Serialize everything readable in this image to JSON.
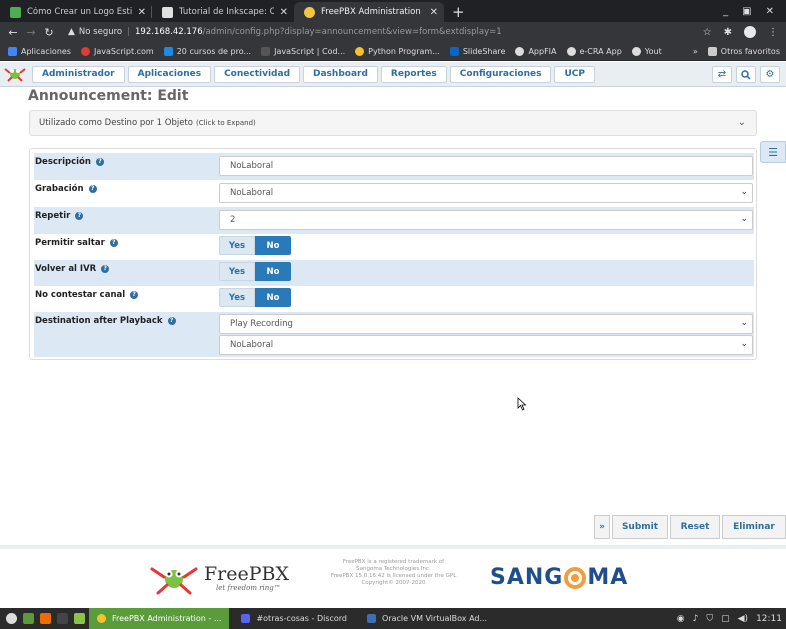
{
  "browser": {
    "tabs": [
      {
        "title": "Cómo Crear un Logo Estilo G",
        "favicon_color": "#4caf50",
        "active": false
      },
      {
        "title": "Tutorial de Inkscape: Cómo d",
        "favicon_color": "#e0e0e0",
        "active": false
      },
      {
        "title": "FreePBX Administration",
        "favicon_color": "#f5c542",
        "active": true
      }
    ],
    "url": {
      "security_label": "No seguro",
      "host": "192.168.42.176",
      "path": "/admin/config.php?display=announcement&view=form&extdisplay=1"
    },
    "bookmarks": [
      {
        "label": "Aplicaciones",
        "color": "#4285f4"
      },
      {
        "label": "JavaScript.com",
        "color": "#e53935"
      },
      {
        "label": "20 cursos de pro...",
        "color": "#1e88e5"
      },
      {
        "label": "JavaScript | Cod...",
        "color": "#555555"
      },
      {
        "label": "Python Program...",
        "color": "#fbc02d"
      },
      {
        "label": "SlideShare",
        "color": "#0a66c2"
      },
      {
        "label": "AppFIA",
        "color": "#dddddd"
      },
      {
        "label": "e-CRA App",
        "color": "#dddddd"
      },
      {
        "label": "Yout",
        "color": "#dddddd"
      }
    ],
    "bookmarks_overflow": "»",
    "other_bookmarks": "Otros favoritos"
  },
  "nav": {
    "items": [
      "Administrador",
      "Aplicaciones",
      "Conectividad",
      "Dashboard",
      "Reportes",
      "Configuraciones",
      "UCP"
    ]
  },
  "page": {
    "title": "Announcement: Edit",
    "used_as": "Utilizado como Destino por 1 Objeto",
    "used_as_hint": "(Click to Expand)"
  },
  "form": {
    "descripcion": {
      "label": "Descripción",
      "value": "NoLaboral"
    },
    "grabacion": {
      "label": "Grabación",
      "value": "NoLaboral"
    },
    "repetir": {
      "label": "Repetir",
      "value": "2"
    },
    "permitir_saltar": {
      "label": "Permitir saltar",
      "yes": "Yes",
      "no": "No",
      "selected": "No"
    },
    "volver_ivr": {
      "label": "Volver al IVR",
      "yes": "Yes",
      "no": "No",
      "selected": "No"
    },
    "no_contestar": {
      "label": "No contestar canal",
      "yes": "Yes",
      "no": "No",
      "selected": "No"
    },
    "destination": {
      "label": "Destination after Playback",
      "type_value": "Play Recording",
      "target_value": "NoLaboral"
    }
  },
  "actions": {
    "expand": "»",
    "submit": "Submit",
    "reset": "Reset",
    "delete": "Eliminar"
  },
  "footer": {
    "brand": "FreePBX",
    "tagline": "let freedom ring™",
    "legal_1": "FreePBX is a registered trademark of",
    "legal_2": "Sangoma Technologies Inc.",
    "legal_3": "FreePBX 15.0.16.42 is licensed under the GPL",
    "legal_4": "Copyright© 2007-2020",
    "sangoma_left": "SANG",
    "sangoma_right": "MA"
  },
  "taskbar": {
    "tasks": [
      {
        "label": "FreePBX Administration - ...",
        "active": true
      },
      {
        "label": "#otras-cosas - Discord",
        "active": false
      },
      {
        "label": "Oracle VM VirtualBox Ad...",
        "active": false
      }
    ],
    "clock": "12:11"
  },
  "colors": {
    "primary": "#2f6f9f",
    "row_shade": "#dce9f5",
    "toggle_active": "#2a79b8",
    "sangoma_blue": "#1f4e8c",
    "sangoma_orange": "#f39c3b"
  }
}
